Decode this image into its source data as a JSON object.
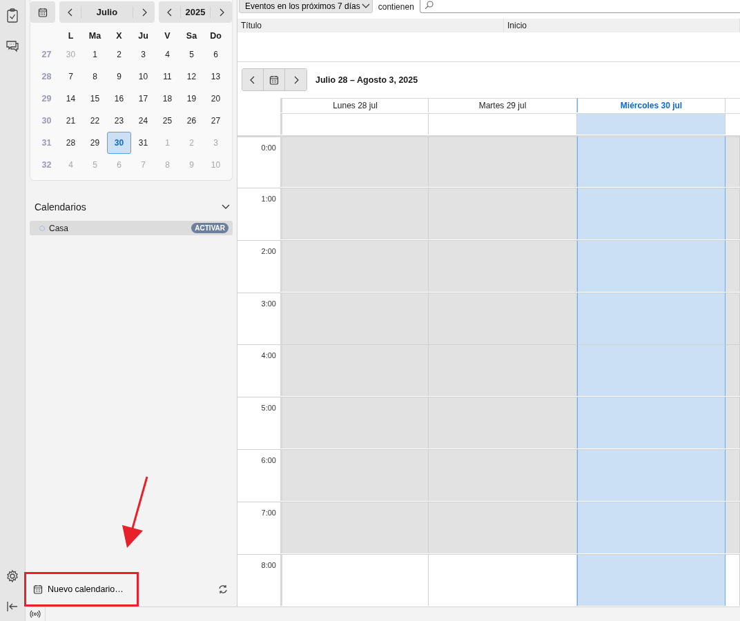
{
  "mini_calendar": {
    "month": "Julio",
    "year": "2025",
    "weekdays": [
      "L",
      "Ma",
      "X",
      "Ju",
      "V",
      "Sa",
      "Do"
    ],
    "weeks": [
      {
        "week": "27",
        "days": [
          {
            "label": "30",
            "outside": true,
            "selected": false
          },
          {
            "label": "1",
            "outside": false,
            "selected": false
          },
          {
            "label": "2",
            "outside": false,
            "selected": false
          },
          {
            "label": "3",
            "outside": false,
            "selected": false
          },
          {
            "label": "4",
            "outside": false,
            "selected": false
          },
          {
            "label": "5",
            "outside": false,
            "selected": false
          },
          {
            "label": "6",
            "outside": false,
            "selected": false
          }
        ]
      },
      {
        "week": "28",
        "days": [
          {
            "label": "7",
            "outside": false,
            "selected": false
          },
          {
            "label": "8",
            "outside": false,
            "selected": false
          },
          {
            "label": "9",
            "outside": false,
            "selected": false
          },
          {
            "label": "10",
            "outside": false,
            "selected": false
          },
          {
            "label": "11",
            "outside": false,
            "selected": false
          },
          {
            "label": "12",
            "outside": false,
            "selected": false
          },
          {
            "label": "13",
            "outside": false,
            "selected": false
          }
        ]
      },
      {
        "week": "29",
        "days": [
          {
            "label": "14",
            "outside": false,
            "selected": false
          },
          {
            "label": "15",
            "outside": false,
            "selected": false
          },
          {
            "label": "16",
            "outside": false,
            "selected": false
          },
          {
            "label": "17",
            "outside": false,
            "selected": false
          },
          {
            "label": "18",
            "outside": false,
            "selected": false
          },
          {
            "label": "19",
            "outside": false,
            "selected": false
          },
          {
            "label": "20",
            "outside": false,
            "selected": false
          }
        ]
      },
      {
        "week": "30",
        "days": [
          {
            "label": "21",
            "outside": false,
            "selected": false
          },
          {
            "label": "22",
            "outside": false,
            "selected": false
          },
          {
            "label": "23",
            "outside": false,
            "selected": false
          },
          {
            "label": "24",
            "outside": false,
            "selected": false
          },
          {
            "label": "25",
            "outside": false,
            "selected": false
          },
          {
            "label": "26",
            "outside": false,
            "selected": false
          },
          {
            "label": "27",
            "outside": false,
            "selected": false
          }
        ]
      },
      {
        "week": "31",
        "days": [
          {
            "label": "28",
            "outside": false,
            "selected": false
          },
          {
            "label": "29",
            "outside": false,
            "selected": false
          },
          {
            "label": "30",
            "outside": false,
            "selected": true
          },
          {
            "label": "31",
            "outside": false,
            "selected": false
          },
          {
            "label": "1",
            "outside": true,
            "selected": false
          },
          {
            "label": "2",
            "outside": true,
            "selected": false
          },
          {
            "label": "3",
            "outside": true,
            "selected": false
          }
        ]
      },
      {
        "week": "32",
        "days": [
          {
            "label": "4",
            "outside": true,
            "selected": false
          },
          {
            "label": "5",
            "outside": true,
            "selected": false
          },
          {
            "label": "6",
            "outside": true,
            "selected": false
          },
          {
            "label": "7",
            "outside": true,
            "selected": false
          },
          {
            "label": "8",
            "outside": true,
            "selected": false
          },
          {
            "label": "9",
            "outside": true,
            "selected": false
          },
          {
            "label": "10",
            "outside": true,
            "selected": false
          }
        ]
      }
    ]
  },
  "calendars": {
    "title": "Calendarios",
    "expanded": true,
    "items": [
      {
        "name": "Casa",
        "badge": "ACTIVAR"
      }
    ]
  },
  "new_calendar_button": "Nuevo calendario…",
  "filter": {
    "range": "Eventos en los próximos 7 días",
    "label": "contienen"
  },
  "event_list": {
    "columns": [
      "Título",
      "Inicio"
    ]
  },
  "week_view": {
    "title": "Julio 28 – Agosto 3, 2025",
    "days": [
      {
        "label": "Lunes 28 jul",
        "selected": false
      },
      {
        "label": "Martes 29 jul",
        "selected": false
      },
      {
        "label": "Miércoles 30 jul",
        "selected": true
      }
    ],
    "hours": [
      {
        "label": "0:00",
        "off_hours": true
      },
      {
        "label": "1:00",
        "off_hours": true
      },
      {
        "label": "2:00",
        "off_hours": true
      },
      {
        "label": "3:00",
        "off_hours": true
      },
      {
        "label": "4:00",
        "off_hours": true
      },
      {
        "label": "5:00",
        "off_hours": true
      },
      {
        "label": "6:00",
        "off_hours": true
      },
      {
        "label": "7:00",
        "off_hours": true
      },
      {
        "label": "8:00",
        "off_hours": false
      }
    ]
  }
}
